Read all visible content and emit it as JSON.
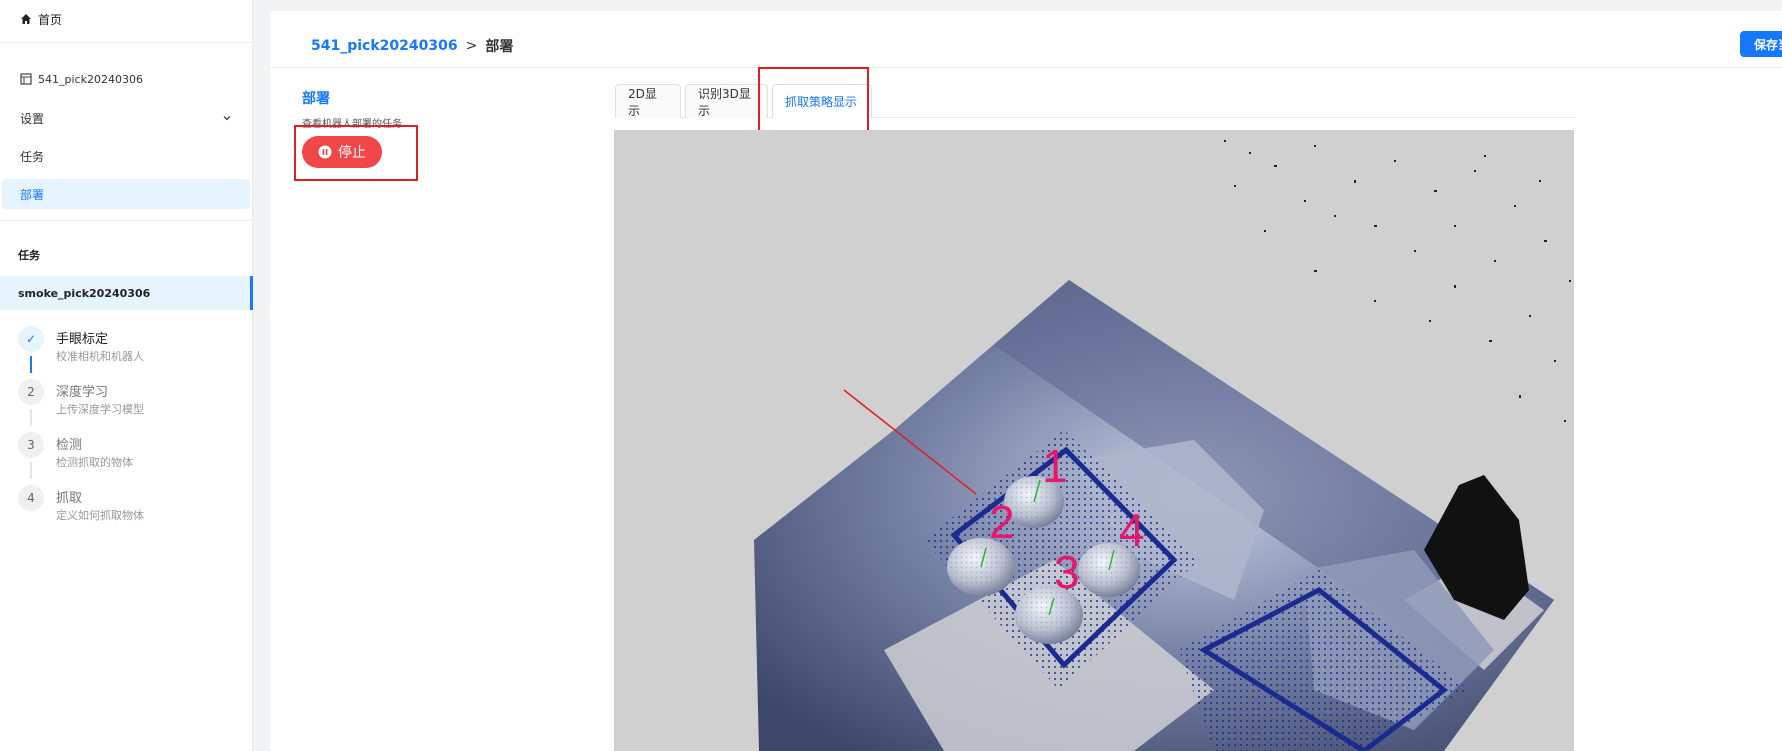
{
  "sidebar": {
    "home_label": "首页",
    "project_label": "541_pick20240306",
    "settings_label": "设置",
    "tasks_label": "任务",
    "deploy_label": "部署",
    "task_section_title": "任务",
    "selected_task": "smoke_pick20240306",
    "steps": [
      {
        "number": "✓",
        "title": "手眼标定",
        "desc": "校准相机和机器人",
        "status": "done"
      },
      {
        "number": "2",
        "title": "深度学习",
        "desc": "上传深度学习模型",
        "status": "pending"
      },
      {
        "number": "3",
        "title": "检测",
        "desc": "检测抓取的物体",
        "status": "pending"
      },
      {
        "number": "4",
        "title": "抓取",
        "desc": "定义如何抓取物体",
        "status": "pending"
      }
    ]
  },
  "header": {
    "breadcrumb_link": "541_pick20240306",
    "breadcrumb_sep": ">",
    "breadcrumb_current": "部署",
    "save_label": "保存当前"
  },
  "deploy": {
    "title": "部署",
    "description": "查看机器人部署的任务",
    "stop_label": "停止"
  },
  "tabs": [
    {
      "label": "2D显示",
      "active": false
    },
    {
      "label": "识别3D显示",
      "active": false
    },
    {
      "label": "抓取策略显示",
      "active": true
    }
  ],
  "viewer": {
    "pick_labels": [
      "1",
      "2",
      "3",
      "4"
    ],
    "label_color": "#e8176c",
    "background_color": "#d0d0d0"
  },
  "colors": {
    "accent": "#1677ff",
    "danger": "#f04848",
    "highlight_box": "#e02020"
  }
}
